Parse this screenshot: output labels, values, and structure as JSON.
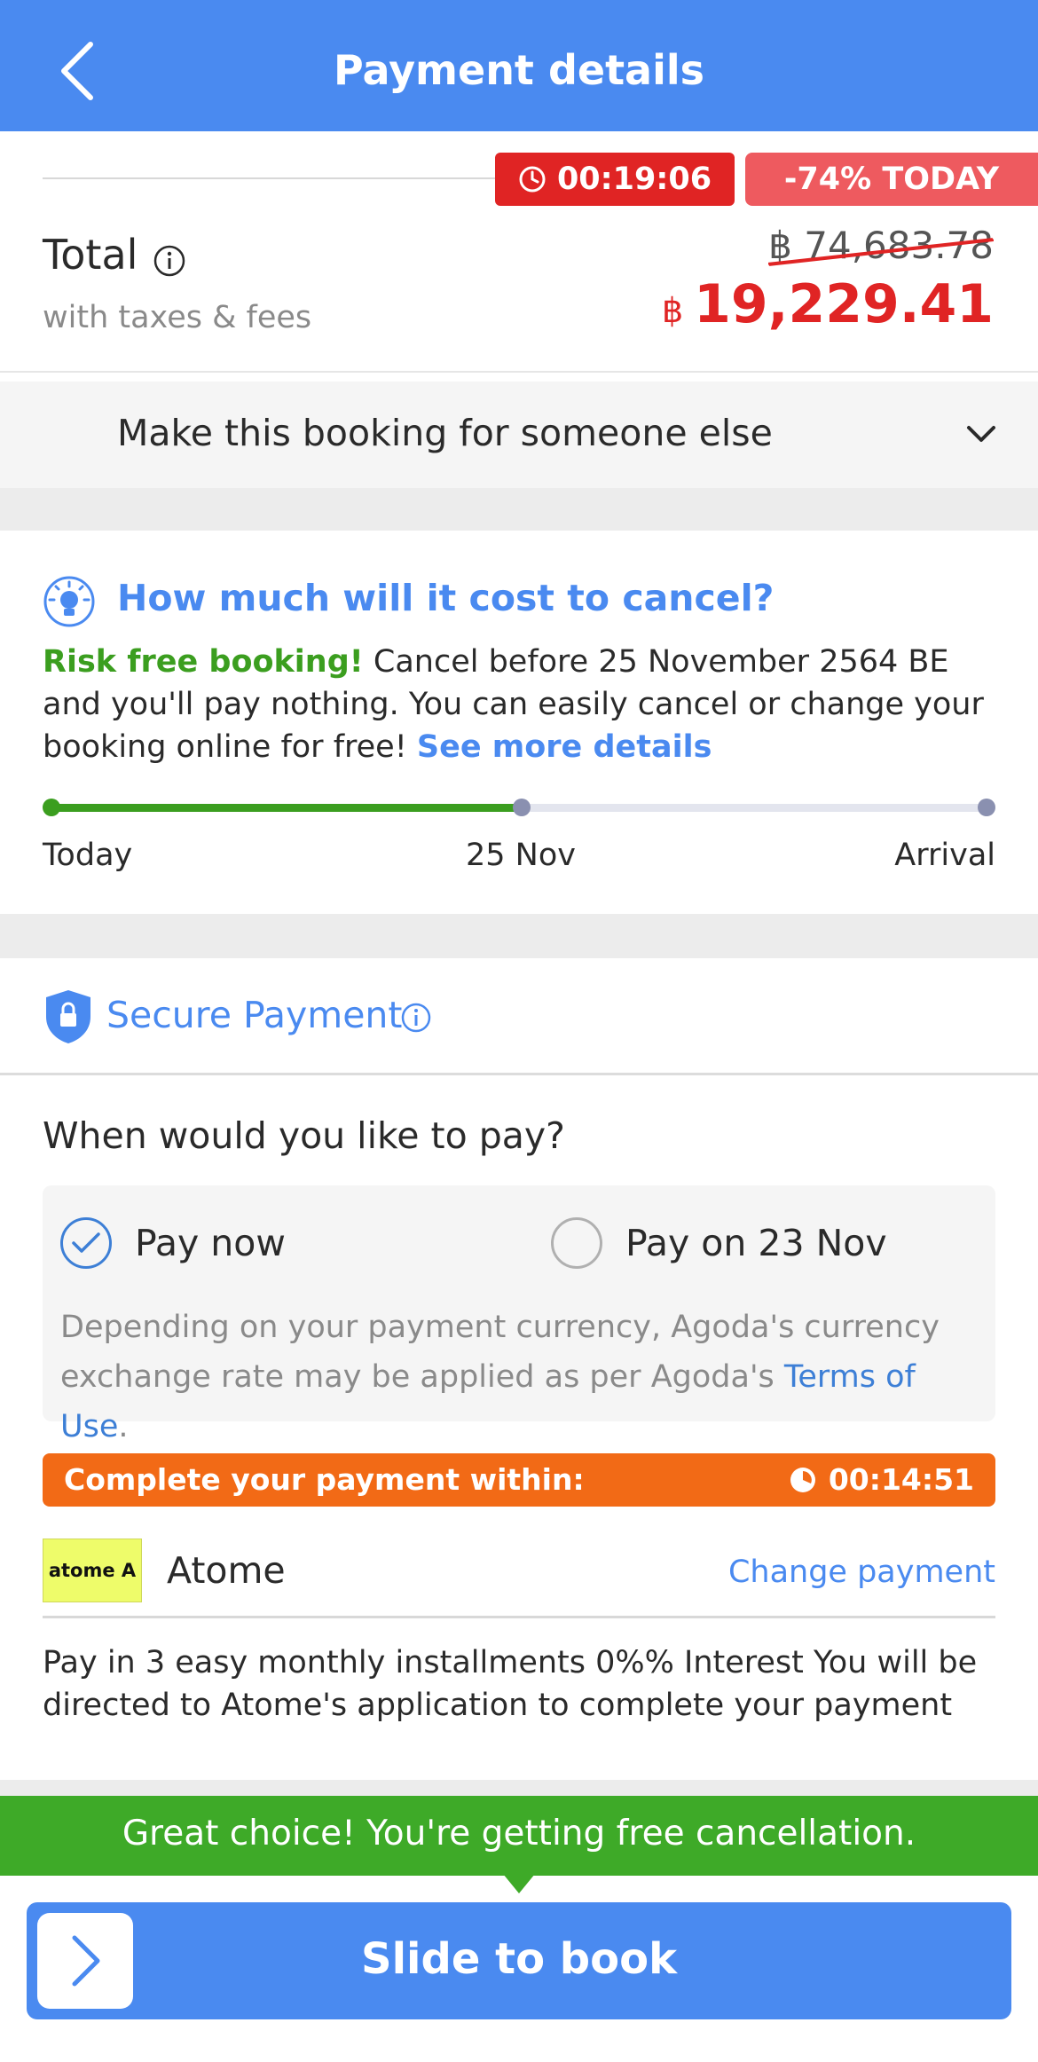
{
  "header": {
    "title": "Payment details"
  },
  "price": {
    "timer": "00:19:06",
    "discount": "-74% TODAY",
    "total_label": "Total",
    "taxes_label": "with taxes & fees",
    "old_price": "฿ 74,683.78",
    "currency": "฿",
    "new_price": "19,229.41"
  },
  "booking_for": {
    "label": "Make this booking for someone else"
  },
  "cancellation": {
    "title": "How much will it cost to cancel?",
    "risk_free": "Risk free booking!",
    "body": " Cancel before 25 November 2564 BE and you'll pay nothing. You can easily cancel or change your booking online for free! ",
    "link": "See more details",
    "timeline": {
      "start": "Today",
      "middle": "25 Nov",
      "end": "Arrival",
      "progress": 0.5
    }
  },
  "secure": {
    "label": "Secure Payment"
  },
  "payment": {
    "question": "When would you like to pay?",
    "option_now": "Pay now",
    "option_later": "Pay on 23 Nov",
    "selected": "now",
    "note": "Depending on your payment currency, Agoda's currency exchange rate may be applied as per Agoda's ",
    "note_link": "Terms of Use",
    "note_end": ".",
    "countdown_label": "Complete your payment within:",
    "countdown_time": "00:14:51",
    "method_logo": "atome A",
    "method_name": "Atome",
    "change_link": "Change payment",
    "installments": "Pay in 3 easy monthly installments 0%% Interest You will be directed to Atome's application to complete your payment"
  },
  "banner": {
    "text": "Great choice! You're getting free cancellation."
  },
  "slide": {
    "label": "Slide to book"
  },
  "colors": {
    "primary": "#4a8af0",
    "red": "#e02424",
    "green": "#3eaa28",
    "orange": "#f26a16"
  }
}
